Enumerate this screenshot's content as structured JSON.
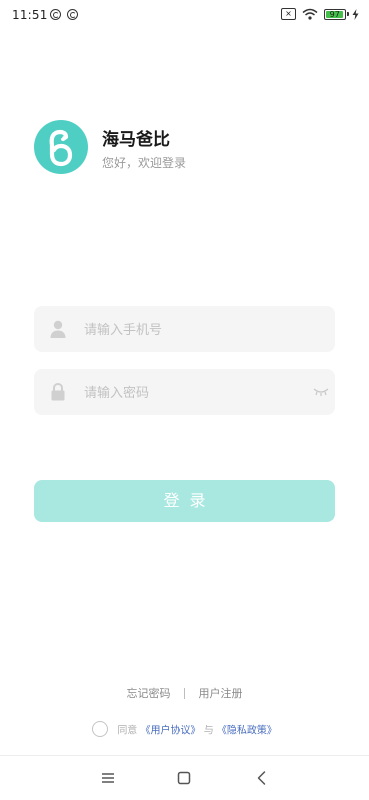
{
  "status_bar": {
    "time": "11:51",
    "battery_level": "97",
    "icons": [
      "notification-icon",
      "notification-icon",
      "sim-x-icon",
      "wifi-icon",
      "battery-icon",
      "charging-icon"
    ]
  },
  "brand": {
    "name": "海马爸比",
    "subtitle": "您好，欢迎登录",
    "logo_color": "#4fcfc4"
  },
  "form": {
    "phone_placeholder": "请输入手机号",
    "password_placeholder": "请输入密码",
    "login_label": "登录"
  },
  "links": {
    "forgot": "忘记密码",
    "register": "用户注册"
  },
  "agreement": {
    "prefix": "同意",
    "user_agreement": "《用户协议》",
    "joiner": "与",
    "privacy_policy": "《隐私政策》"
  },
  "colors": {
    "accent": "#4fcfc4",
    "button": "#a8e8e1",
    "link": "#4a6fbf"
  }
}
